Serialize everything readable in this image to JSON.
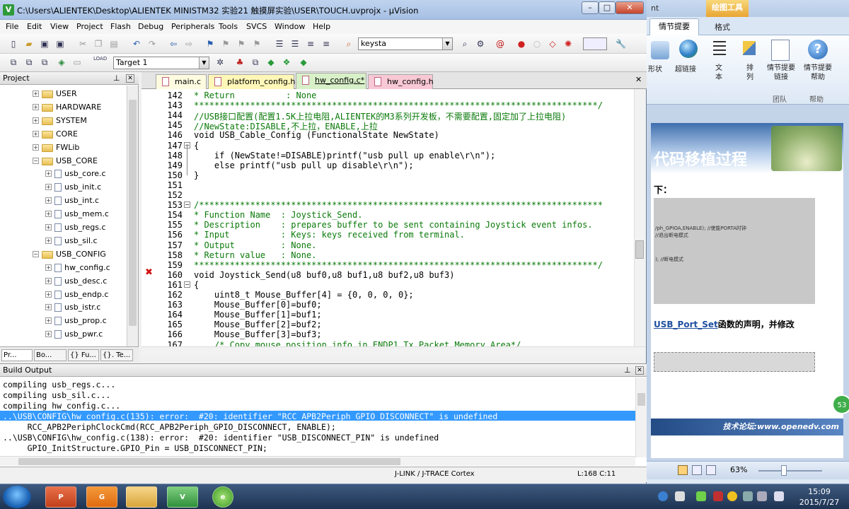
{
  "ppt": {
    "title_fragment": "nt",
    "drawing_tools": "绘图工具",
    "tab_active": "情节提要",
    "tab_format": "格式",
    "ribbon": {
      "shape": "形状",
      "hyperlink": "超链接",
      "text": "文本",
      "arrange": "排列",
      "storyboard_links": "情节提要链接",
      "storyboard_help": "情节提要帮助",
      "group_team": "团队",
      "group_help": "帮助"
    },
    "slide": {
      "title": "代码移植过程",
      "xia": "下：",
      "box_line1": "/ph_GPIOA,ENABLE);    //使能PORTA时钟",
      "box_line2": "//退出断电模式",
      "box_line3": ");  //断电模式",
      "desc_link": "USB_Port_Set",
      "desc_rest": "函数的声明，并修改",
      "footer": "技术论坛:www.openedv.com",
      "badge": "53"
    },
    "zoom": "63%"
  },
  "uv": {
    "title": "C:\\Users\\ALIENTEK\\Desktop\\ALIENTEK MINISTM32 实验21 触摸屏实验\\USER\\TOUCH.uvprojx - µVision",
    "logo": "V",
    "menus": [
      "File",
      "Edit",
      "View",
      "Project",
      "Flash",
      "Debug",
      "Peripherals",
      "Tools",
      "SVCS",
      "Window",
      "Help"
    ],
    "find_combo": "keysta",
    "target_combo": "Target 1",
    "project_header": "Project",
    "tree": [
      {
        "label": "USER",
        "type": "folder"
      },
      {
        "label": "HARDWARE",
        "type": "folder"
      },
      {
        "label": "SYSTEM",
        "type": "folder"
      },
      {
        "label": "CORE",
        "type": "folder"
      },
      {
        "label": "FWLib",
        "type": "folder"
      },
      {
        "label": "USB_CORE",
        "type": "folder-open"
      },
      {
        "label": "usb_core.c",
        "type": "file"
      },
      {
        "label": "usb_init.c",
        "type": "file"
      },
      {
        "label": "usb_int.c",
        "type": "file"
      },
      {
        "label": "usb_mem.c",
        "type": "file"
      },
      {
        "label": "usb_regs.c",
        "type": "file"
      },
      {
        "label": "usb_sil.c",
        "type": "file"
      },
      {
        "label": "USB_CONFIG",
        "type": "folder-open"
      },
      {
        "label": "hw_config.c",
        "type": "file"
      },
      {
        "label": "usb_desc.c",
        "type": "file"
      },
      {
        "label": "usb_endp.c",
        "type": "file"
      },
      {
        "label": "usb_istr.c",
        "type": "file"
      },
      {
        "label": "usb_prop.c",
        "type": "file"
      },
      {
        "label": "usb_pwr.c",
        "type": "file"
      }
    ],
    "panel_tabs": [
      "Pr...",
      "Bo...",
      "{} Fu...",
      "{}. Te..."
    ],
    "editor_tabs": [
      {
        "label": "main.c",
        "active": false,
        "color": "#fffbe0"
      },
      {
        "label": "platform_config.h",
        "active": false,
        "color": "#fff7b8"
      },
      {
        "label": "hw_config.c*",
        "active": true,
        "color": "#d8f0c8"
      },
      {
        "label": "hw_config.h",
        "active": false,
        "color": "#f8c8d4"
      }
    ],
    "code": [
      {
        "n": "142",
        "t": "* Return          : None",
        "c": "cm"
      },
      {
        "n": "143",
        "t": "*******************************************************************************/",
        "c": "cm"
      },
      {
        "n": "144",
        "t": "//USB接口配置(配置1.5K上拉电阻,ALIENTEK的M3系列开发板，不需要配置,固定加了上拉电阻)",
        "c": "cm"
      },
      {
        "n": "145",
        "t": "//NewState:DISABLE,不上拉，ENABLE,上拉",
        "c": "cm"
      },
      {
        "n": "146",
        "t": "void USB_Cable_Config (FunctionalState NewState)",
        "c": ""
      },
      {
        "n": "147",
        "t": "{",
        "c": ""
      },
      {
        "n": "148",
        "t": "    if (NewState!=DISABLE)printf(\"usb pull up enable\\r\\n\");",
        "c": ""
      },
      {
        "n": "149",
        "t": "    else printf(\"usb pull up disable\\r\\n\");",
        "c": ""
      },
      {
        "n": "150",
        "t": "}",
        "c": ""
      },
      {
        "n": "151",
        "t": "",
        "c": ""
      },
      {
        "n": "152",
        "t": "",
        "c": ""
      },
      {
        "n": "153",
        "t": "/*******************************************************************************",
        "c": "cm"
      },
      {
        "n": "154",
        "t": "* Function Name  : Joystick_Send.",
        "c": "cm"
      },
      {
        "n": "155",
        "t": "* Description    : prepares buffer to be sent containing Joystick event infos.",
        "c": "cm"
      },
      {
        "n": "156",
        "t": "* Input          : Keys: keys received from terminal.",
        "c": "cm"
      },
      {
        "n": "157",
        "t": "* Output         : None.",
        "c": "cm"
      },
      {
        "n": "158",
        "t": "* Return value   : None.",
        "c": "cm"
      },
      {
        "n": "159",
        "t": "*******************************************************************************/",
        "c": "cm"
      },
      {
        "n": "160",
        "t": "void Joystick_Send(u8 buf0,u8 buf1,u8 buf2,u8 buf3)",
        "c": ""
      },
      {
        "n": "161",
        "t": "{",
        "c": ""
      },
      {
        "n": "162",
        "t": "    uint8_t Mouse_Buffer[4] = {0, 0, 0, 0};",
        "c": ""
      },
      {
        "n": "163",
        "t": "    Mouse_Buffer[0]=buf0;",
        "c": ""
      },
      {
        "n": "164",
        "t": "    Mouse_Buffer[1]=buf1;",
        "c": ""
      },
      {
        "n": "165",
        "t": "    Mouse_Buffer[2]=buf2;",
        "c": ""
      },
      {
        "n": "166",
        "t": "    Mouse_Buffer[3]=buf3;",
        "c": ""
      },
      {
        "n": "167",
        "t": "    /* Copy mouse position info in ENDP1 Tx Packet Memory Area*/",
        "c": "cm"
      }
    ],
    "error_mark": "✖",
    "build_header": "Build Output",
    "build_lines": [
      "compiling usb_regs.c...",
      "compiling usb_sil.c...",
      "compiling hw_config.c...",
      "..\\USB\\CONFIG\\hw_config.c(135): error:  #20: identifier \"RCC_APB2Periph_GPIO_DISCONNECT\" is undefined",
      "     RCC_APB2PeriphClockCmd(RCC_APB2Periph_GPIO_DISCONNECT, ENABLE);",
      "..\\USB\\CONFIG\\hw_config.c(138): error:  #20: identifier \"USB_DISCONNECT_PIN\" is undefined",
      "     GPIO_InitStructure.GPIO_Pin = USB_DISCONNECT_PIN;"
    ],
    "status_debugger": "J-LINK / J-TRACE Cortex",
    "status_pos": "L:168 C:11"
  },
  "taskbar": {
    "time": "15:09",
    "date": "2015/7/27",
    "apps": [
      "P",
      "G",
      "",
      "V",
      "e"
    ]
  }
}
